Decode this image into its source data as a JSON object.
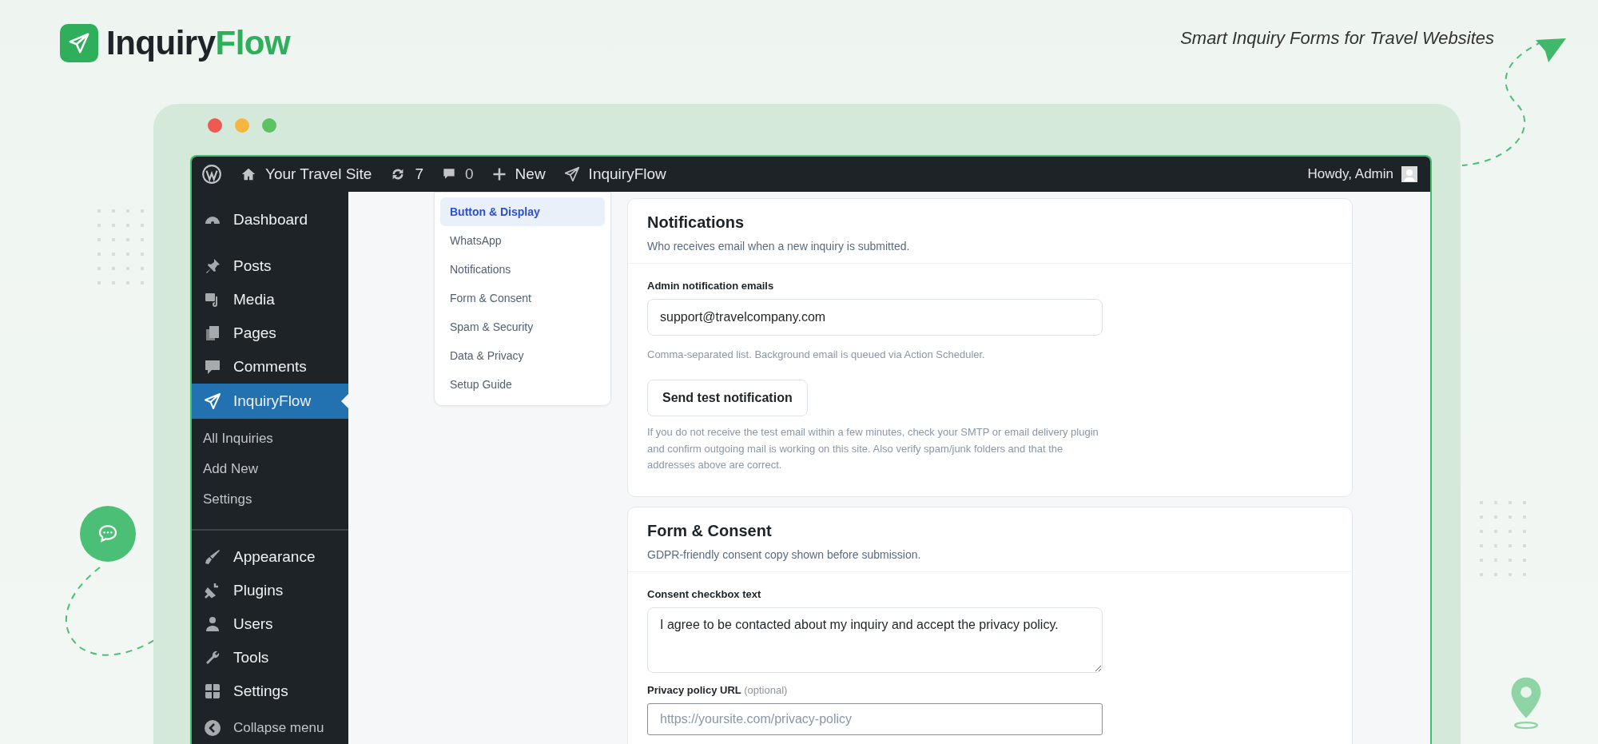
{
  "brand": {
    "name_main": "Inquiry",
    "name_accent": "Flow",
    "tagline": "Smart Inquiry Forms for Travel Websites"
  },
  "window_controls": [
    {
      "color": "#ee5a52"
    },
    {
      "color": "#f4b63f"
    },
    {
      "color": "#5dc262"
    }
  ],
  "admin_bar": {
    "site_name": "Your Travel Site",
    "updates_count": "7",
    "comments_count": "0",
    "new_label": "New",
    "plugin_label": "InquiryFlow",
    "greeting": "Howdy, Admin"
  },
  "sidebar": {
    "groups": [
      [
        {
          "label": "Dashboard",
          "selected": false
        }
      ],
      [
        {
          "label": "Posts",
          "selected": false
        },
        {
          "label": "Media",
          "selected": false
        },
        {
          "label": "Pages",
          "selected": false
        },
        {
          "label": "Comments",
          "selected": false
        },
        {
          "label": "InquiryFlow",
          "selected": true,
          "children": [
            {
              "label": "All Inquiries",
              "selected": false
            },
            {
              "label": "Add New",
              "selected": false
            },
            {
              "label": "Settings",
              "selected": false
            }
          ]
        }
      ],
      [
        {
          "label": "Appearance",
          "selected": false
        },
        {
          "label": "Plugins",
          "selected": false
        },
        {
          "label": "Users",
          "selected": false
        },
        {
          "label": "Tools",
          "selected": false
        },
        {
          "label": "Settings",
          "selected": false
        }
      ]
    ],
    "collapse_label": "Collapse menu"
  },
  "settings_nav": [
    {
      "label": "Button & Display",
      "selected": true
    },
    {
      "label": "WhatsApp",
      "selected": false
    },
    {
      "label": "Notifications",
      "selected": false
    },
    {
      "label": "Form & Consent",
      "selected": false
    },
    {
      "label": "Spam & Security",
      "selected": false
    },
    {
      "label": "Data & Privacy",
      "selected": false
    },
    {
      "label": "Setup Guide",
      "selected": false
    }
  ],
  "sections": [
    {
      "title": "Notifications",
      "description": "Who receives email when a new inquiry is submitted.",
      "fields": [
        {
          "kind": "input",
          "label": "Admin notification emails",
          "value": "support@travelcompany.com"
        },
        {
          "kind": "help",
          "text": "Comma-separated list. Background email is queued via Action Scheduler."
        },
        {
          "kind": "button",
          "label": "Send test notification"
        },
        {
          "kind": "help",
          "text": "If you do not receive the test email within a few minutes, check your SMTP or email delivery plugin and confirm outgoing mail is working on this site. Also verify spam/junk folders and that the addresses above are correct."
        }
      ]
    },
    {
      "title": "Form & Consent",
      "description": "GDPR-friendly consent copy shown before submission.",
      "fields": [
        {
          "kind": "textarea",
          "label": "Consent checkbox text",
          "value": "I agree to be contacted about my inquiry and accept the privacy policy."
        },
        {
          "kind": "input",
          "label": "Privacy policy URL",
          "note": "(optional)",
          "placeholder": "https://yoursite.com/privacy-policy"
        }
      ]
    }
  ]
}
